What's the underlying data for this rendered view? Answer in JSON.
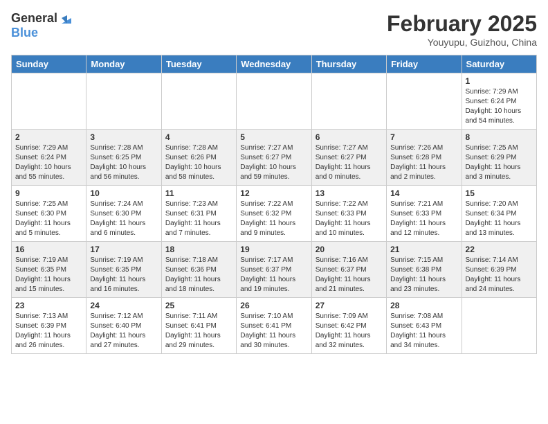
{
  "logo": {
    "general": "General",
    "blue": "Blue"
  },
  "title": "February 2025",
  "location": "Youyupu, Guizhou, China",
  "weekdays": [
    "Sunday",
    "Monday",
    "Tuesday",
    "Wednesday",
    "Thursday",
    "Friday",
    "Saturday"
  ],
  "weeks": [
    [
      {
        "day": "",
        "info": ""
      },
      {
        "day": "",
        "info": ""
      },
      {
        "day": "",
        "info": ""
      },
      {
        "day": "",
        "info": ""
      },
      {
        "day": "",
        "info": ""
      },
      {
        "day": "",
        "info": ""
      },
      {
        "day": "1",
        "info": "Sunrise: 7:29 AM\nSunset: 6:24 PM\nDaylight: 10 hours\nand 54 minutes."
      }
    ],
    [
      {
        "day": "2",
        "info": "Sunrise: 7:29 AM\nSunset: 6:24 PM\nDaylight: 10 hours\nand 55 minutes."
      },
      {
        "day": "3",
        "info": "Sunrise: 7:28 AM\nSunset: 6:25 PM\nDaylight: 10 hours\nand 56 minutes."
      },
      {
        "day": "4",
        "info": "Sunrise: 7:28 AM\nSunset: 6:26 PM\nDaylight: 10 hours\nand 58 minutes."
      },
      {
        "day": "5",
        "info": "Sunrise: 7:27 AM\nSunset: 6:27 PM\nDaylight: 10 hours\nand 59 minutes."
      },
      {
        "day": "6",
        "info": "Sunrise: 7:27 AM\nSunset: 6:27 PM\nDaylight: 11 hours\nand 0 minutes."
      },
      {
        "day": "7",
        "info": "Sunrise: 7:26 AM\nSunset: 6:28 PM\nDaylight: 11 hours\nand 2 minutes."
      },
      {
        "day": "8",
        "info": "Sunrise: 7:25 AM\nSunset: 6:29 PM\nDaylight: 11 hours\nand 3 minutes."
      }
    ],
    [
      {
        "day": "9",
        "info": "Sunrise: 7:25 AM\nSunset: 6:30 PM\nDaylight: 11 hours\nand 5 minutes."
      },
      {
        "day": "10",
        "info": "Sunrise: 7:24 AM\nSunset: 6:30 PM\nDaylight: 11 hours\nand 6 minutes."
      },
      {
        "day": "11",
        "info": "Sunrise: 7:23 AM\nSunset: 6:31 PM\nDaylight: 11 hours\nand 7 minutes."
      },
      {
        "day": "12",
        "info": "Sunrise: 7:22 AM\nSunset: 6:32 PM\nDaylight: 11 hours\nand 9 minutes."
      },
      {
        "day": "13",
        "info": "Sunrise: 7:22 AM\nSunset: 6:33 PM\nDaylight: 11 hours\nand 10 minutes."
      },
      {
        "day": "14",
        "info": "Sunrise: 7:21 AM\nSunset: 6:33 PM\nDaylight: 11 hours\nand 12 minutes."
      },
      {
        "day": "15",
        "info": "Sunrise: 7:20 AM\nSunset: 6:34 PM\nDaylight: 11 hours\nand 13 minutes."
      }
    ],
    [
      {
        "day": "16",
        "info": "Sunrise: 7:19 AM\nSunset: 6:35 PM\nDaylight: 11 hours\nand 15 minutes."
      },
      {
        "day": "17",
        "info": "Sunrise: 7:19 AM\nSunset: 6:35 PM\nDaylight: 11 hours\nand 16 minutes."
      },
      {
        "day": "18",
        "info": "Sunrise: 7:18 AM\nSunset: 6:36 PM\nDaylight: 11 hours\nand 18 minutes."
      },
      {
        "day": "19",
        "info": "Sunrise: 7:17 AM\nSunset: 6:37 PM\nDaylight: 11 hours\nand 19 minutes."
      },
      {
        "day": "20",
        "info": "Sunrise: 7:16 AM\nSunset: 6:37 PM\nDaylight: 11 hours\nand 21 minutes."
      },
      {
        "day": "21",
        "info": "Sunrise: 7:15 AM\nSunset: 6:38 PM\nDaylight: 11 hours\nand 23 minutes."
      },
      {
        "day": "22",
        "info": "Sunrise: 7:14 AM\nSunset: 6:39 PM\nDaylight: 11 hours\nand 24 minutes."
      }
    ],
    [
      {
        "day": "23",
        "info": "Sunrise: 7:13 AM\nSunset: 6:39 PM\nDaylight: 11 hours\nand 26 minutes."
      },
      {
        "day": "24",
        "info": "Sunrise: 7:12 AM\nSunset: 6:40 PM\nDaylight: 11 hours\nand 27 minutes."
      },
      {
        "day": "25",
        "info": "Sunrise: 7:11 AM\nSunset: 6:41 PM\nDaylight: 11 hours\nand 29 minutes."
      },
      {
        "day": "26",
        "info": "Sunrise: 7:10 AM\nSunset: 6:41 PM\nDaylight: 11 hours\nand 30 minutes."
      },
      {
        "day": "27",
        "info": "Sunrise: 7:09 AM\nSunset: 6:42 PM\nDaylight: 11 hours\nand 32 minutes."
      },
      {
        "day": "28",
        "info": "Sunrise: 7:08 AM\nSunset: 6:43 PM\nDaylight: 11 hours\nand 34 minutes."
      },
      {
        "day": "",
        "info": ""
      }
    ]
  ]
}
